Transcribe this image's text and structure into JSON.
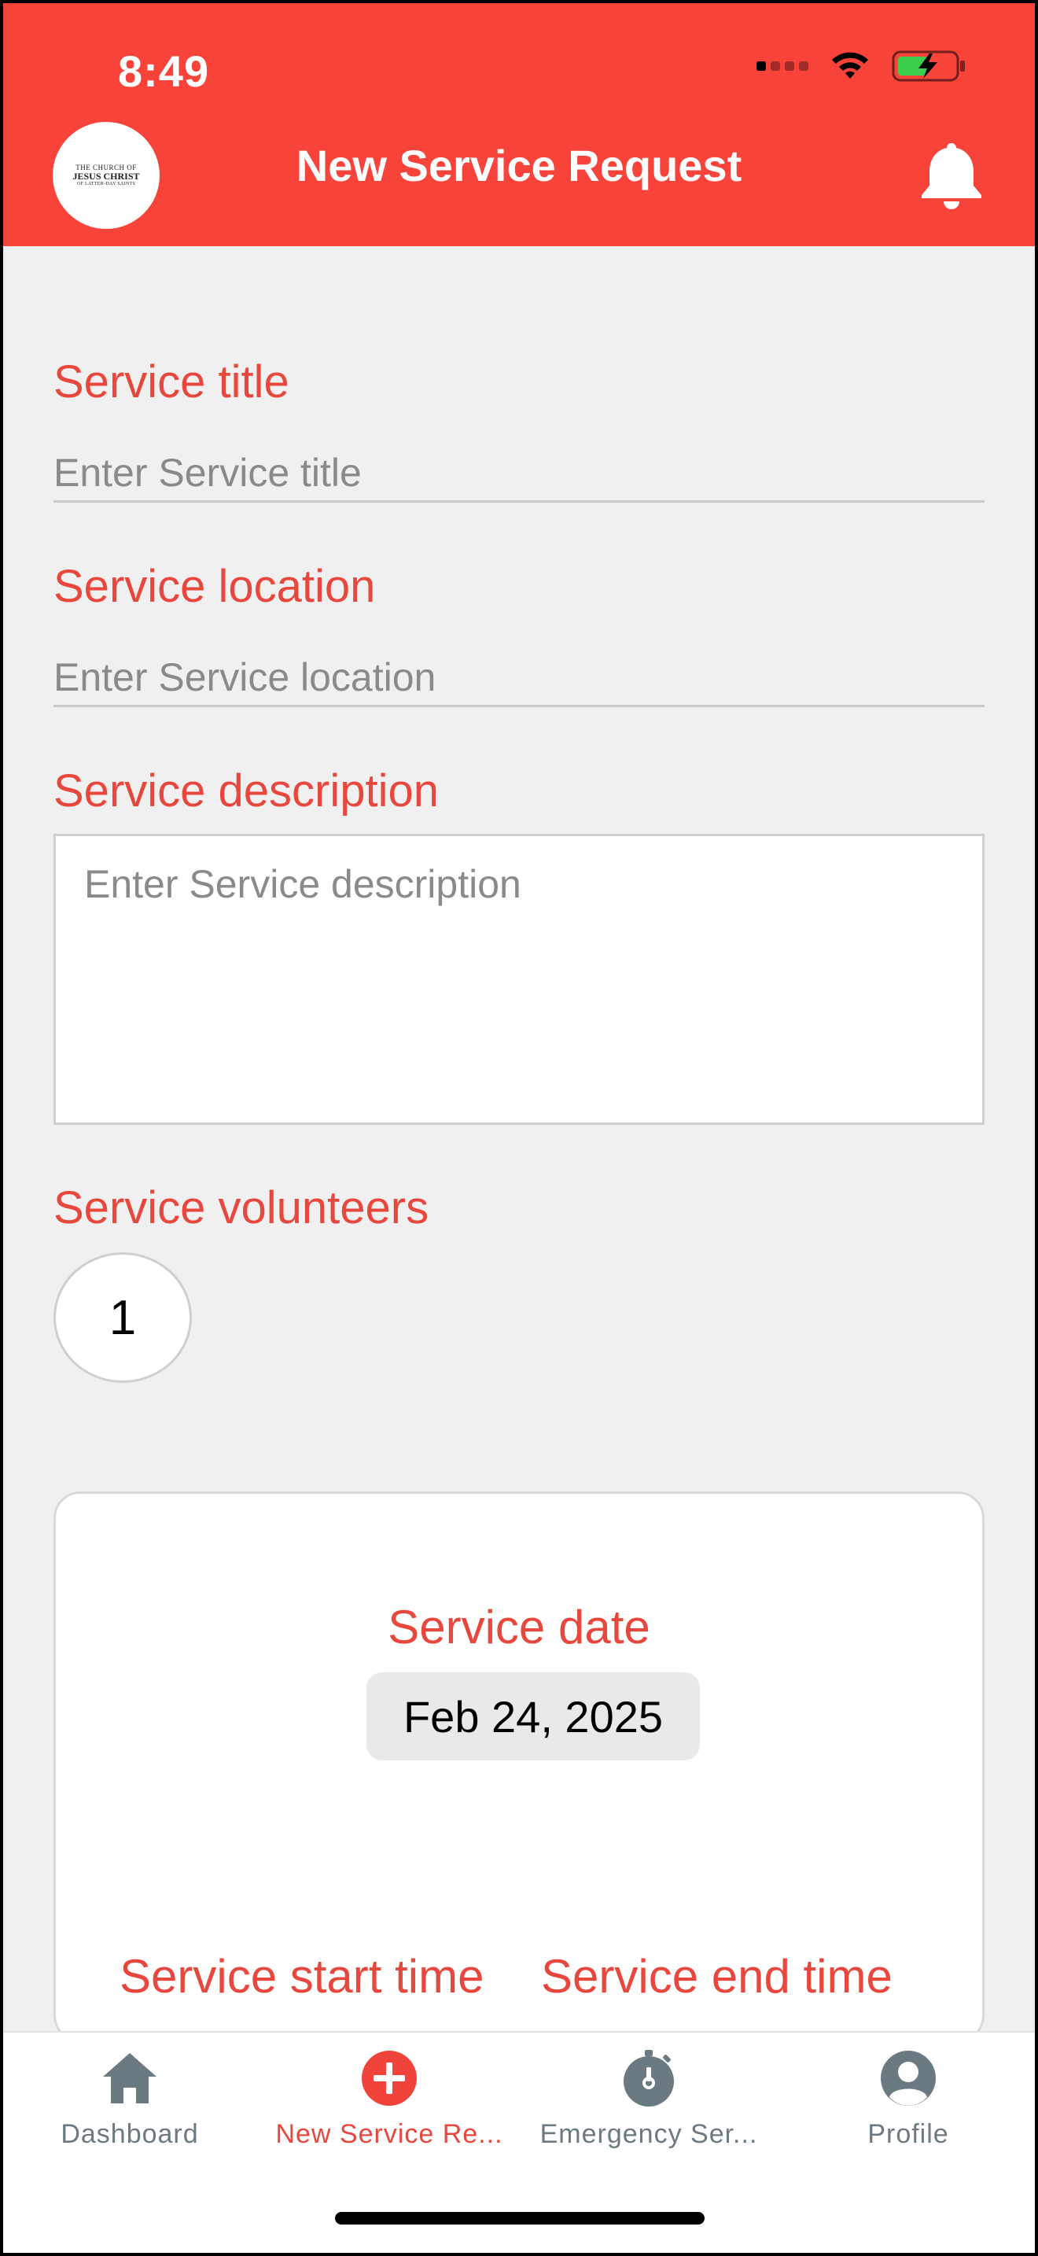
{
  "status_bar": {
    "time": "8:49"
  },
  "header": {
    "title": "New Service Request",
    "logo": {
      "line1": "THE CHURCH OF",
      "line2": "JESUS CHRIST",
      "line3": "OF LATTER-DAY SAINTS"
    }
  },
  "form": {
    "title": {
      "label": "Service title",
      "placeholder": "Enter Service title"
    },
    "location": {
      "label": "Service location",
      "placeholder": "Enter Service location"
    },
    "description": {
      "label": "Service description",
      "placeholder": "Enter Service description"
    },
    "volunteers": {
      "label": "Service volunteers",
      "value": "1"
    },
    "date": {
      "label": "Service date",
      "value": "Feb 24, 2025"
    },
    "start_time": {
      "label": "Service start time"
    },
    "end_time": {
      "label": "Service end time"
    }
  },
  "tabs": [
    {
      "label": "Dashboard",
      "icon": "home-icon",
      "active": false
    },
    {
      "label": "New Service Re...",
      "icon": "plus-circle-icon",
      "active": true
    },
    {
      "label": "Emergency Ser...",
      "icon": "stopwatch-icon",
      "active": false
    },
    {
      "label": "Profile",
      "icon": "user-icon",
      "active": false
    }
  ],
  "colors": {
    "header": "#f8433b",
    "accent": "#e8473d",
    "tab_inactive": "#6b7a80"
  }
}
